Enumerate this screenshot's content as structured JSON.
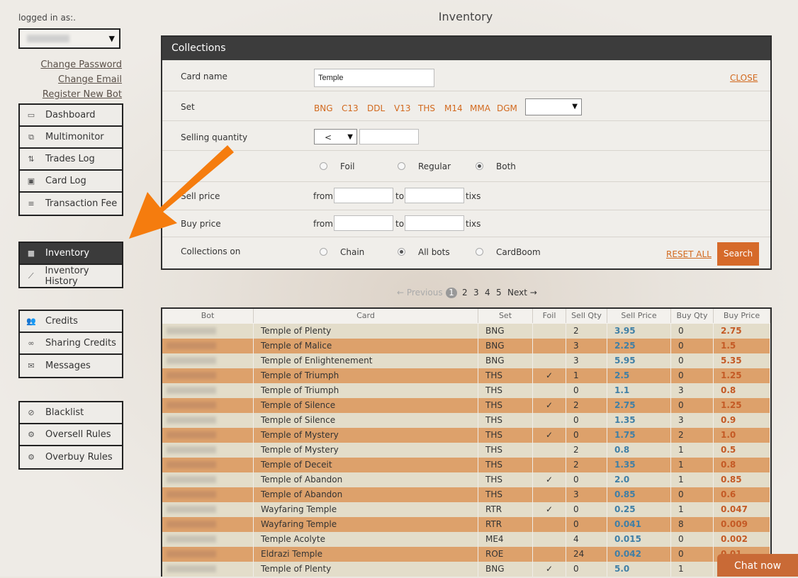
{
  "page_title": "Inventory",
  "sidebar": {
    "logged_in_label": "logged in as:.",
    "account_links": [
      "Change Password",
      "Change Email",
      "Register New Bot"
    ],
    "groups": [
      [
        {
          "label": "Dashboard",
          "icon": "monitor-icon"
        },
        {
          "label": "Multimonitor",
          "icon": "multimonitor-icon"
        },
        {
          "label": "Trades Log",
          "icon": "swap-icon"
        },
        {
          "label": "Card Log",
          "icon": "card-icon"
        },
        {
          "label": "Transaction Fee",
          "icon": "list-icon"
        }
      ],
      [
        {
          "label": "Inventory",
          "icon": "box-icon",
          "active": true
        },
        {
          "label": "Inventory History",
          "icon": "chart-icon"
        }
      ],
      [
        {
          "label": "Credits",
          "icon": "users-icon"
        },
        {
          "label": "Sharing Credits",
          "icon": "link-icon"
        },
        {
          "label": "Messages",
          "icon": "envelope-icon"
        }
      ],
      [
        {
          "label": "Blacklist",
          "icon": "ban-icon"
        },
        {
          "label": "Oversell Rules",
          "icon": "cogs-icon"
        },
        {
          "label": "Overbuy Rules",
          "icon": "cogs-icon"
        }
      ]
    ]
  },
  "collections": {
    "title": "Collections",
    "close_label": "CLOSE",
    "card_name_label": "Card name",
    "card_name_value": "Temple",
    "set_label": "Set",
    "sets": [
      "BNG",
      "C13",
      "DDL",
      "V13",
      "THS",
      "M14",
      "MMA",
      "DGM"
    ],
    "selling_quantity_label": "Selling quantity",
    "quantity_operator": "<",
    "finish_options": [
      "Foil",
      "Regular",
      "Both"
    ],
    "finish_selected": "Both",
    "sell_price_label": "Sell price",
    "buy_price_label": "Buy price",
    "from_label": "from",
    "to_label": "to",
    "unit_label": "tixs",
    "collections_on_label": "Collections on",
    "collections_options": [
      "Chain",
      "All bots",
      "CardBoom"
    ],
    "collections_selected": "All bots",
    "reset_label": "RESET ALL",
    "search_label": "Search"
  },
  "pagination": {
    "prev_label": "← Previous",
    "pages": [
      "1",
      "2",
      "3",
      "4",
      "5"
    ],
    "current": "1",
    "next_label": "Next →"
  },
  "table": {
    "columns": [
      "Bot",
      "Card",
      "Set",
      "Foil",
      "Sell Qty",
      "Sell Price",
      "Buy Qty",
      "Buy Price"
    ],
    "rows": [
      {
        "card": "Temple of Plenty",
        "set": "BNG",
        "foil": "",
        "sell_qty": "2",
        "sell_price": "3.95",
        "buy_qty": "0",
        "buy_price": "2.75"
      },
      {
        "card": "Temple of Malice",
        "set": "BNG",
        "foil": "",
        "sell_qty": "3",
        "sell_price": "2.25",
        "buy_qty": "0",
        "buy_price": "1.5"
      },
      {
        "card": "Temple of Enlightenement",
        "set": "BNG",
        "foil": "",
        "sell_qty": "3",
        "sell_price": "5.95",
        "buy_qty": "0",
        "buy_price": "5.35"
      },
      {
        "card": "Temple of Triumph",
        "set": "THS",
        "foil": "✓",
        "sell_qty": "1",
        "sell_price": "2.5",
        "buy_qty": "0",
        "buy_price": "1.25"
      },
      {
        "card": "Temple of Triumph",
        "set": "THS",
        "foil": "",
        "sell_qty": "0",
        "sell_price": "1.1",
        "buy_qty": "3",
        "buy_price": "0.8"
      },
      {
        "card": "Temple of Silence",
        "set": "THS",
        "foil": "✓",
        "sell_qty": "2",
        "sell_price": "2.75",
        "buy_qty": "0",
        "buy_price": "1.25"
      },
      {
        "card": "Temple of Silence",
        "set": "THS",
        "foil": "",
        "sell_qty": "0",
        "sell_price": "1.35",
        "buy_qty": "3",
        "buy_price": "0.9"
      },
      {
        "card": "Temple of Mystery",
        "set": "THS",
        "foil": "✓",
        "sell_qty": "0",
        "sell_price": "1.75",
        "buy_qty": "2",
        "buy_price": "1.0"
      },
      {
        "card": "Temple of Mystery",
        "set": "THS",
        "foil": "",
        "sell_qty": "2",
        "sell_price": "0.8",
        "buy_qty": "1",
        "buy_price": "0.5"
      },
      {
        "card": "Temple of Deceit",
        "set": "THS",
        "foil": "",
        "sell_qty": "2",
        "sell_price": "1.35",
        "buy_qty": "1",
        "buy_price": "0.8"
      },
      {
        "card": "Temple of Abandon",
        "set": "THS",
        "foil": "✓",
        "sell_qty": "0",
        "sell_price": "2.0",
        "buy_qty": "1",
        "buy_price": "0.85"
      },
      {
        "card": "Temple of Abandon",
        "set": "THS",
        "foil": "",
        "sell_qty": "3",
        "sell_price": "0.85",
        "buy_qty": "0",
        "buy_price": "0.6"
      },
      {
        "card": "Wayfaring Temple",
        "set": "RTR",
        "foil": "✓",
        "sell_qty": "0",
        "sell_price": "0.25",
        "buy_qty": "1",
        "buy_price": "0.047"
      },
      {
        "card": "Wayfaring Temple",
        "set": "RTR",
        "foil": "",
        "sell_qty": "0",
        "sell_price": "0.041",
        "buy_qty": "8",
        "buy_price": "0.009"
      },
      {
        "card": "Temple Acolyte",
        "set": "ME4",
        "foil": "",
        "sell_qty": "4",
        "sell_price": "0.015",
        "buy_qty": "0",
        "buy_price": "0.002"
      },
      {
        "card": "Eldrazi Temple",
        "set": "ROE",
        "foil": "",
        "sell_qty": "24",
        "sell_price": "0.042",
        "buy_qty": "0",
        "buy_price": "0.01"
      },
      {
        "card": "Temple of Plenty",
        "set": "BNG",
        "foil": "✓",
        "sell_qty": "0",
        "sell_price": "5.0",
        "buy_qty": "1",
        "buy_price": ""
      }
    ]
  },
  "chat_label": "Chat now",
  "colors": {
    "accent": "#d2691e",
    "sell_price": "#3f7fa6",
    "buy_price": "#c45a25",
    "dark": "#3c3c3c",
    "arrow": "#f57c0e"
  }
}
